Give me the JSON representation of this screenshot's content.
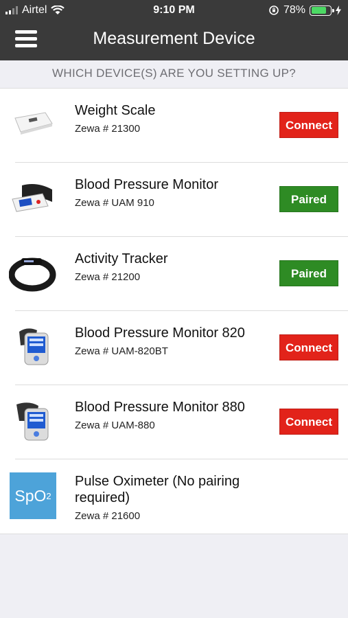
{
  "status": {
    "carrier": "Airtel",
    "time": "9:10 PM",
    "battery": "78%",
    "battery_level": 0.78
  },
  "header": {
    "title": "Measurement Device"
  },
  "subheader": "WHICH DEVICE(S) ARE YOU SETTING UP?",
  "devices": [
    {
      "name": "Weight Scale",
      "model": "Zewa # 21300",
      "action": "Connect",
      "icon": "weight-scale-icon"
    },
    {
      "name": "Blood Pressure Monitor",
      "model": "Zewa # UAM 910",
      "action": "Paired",
      "icon": "bp-monitor-icon"
    },
    {
      "name": "Activity Tracker",
      "model": "Zewa # 21200",
      "action": "Paired",
      "icon": "activity-tracker-icon"
    },
    {
      "name": "Blood Pressure Monitor 820",
      "model": "Zewa # UAM-820BT",
      "action": "Connect",
      "icon": "bp-monitor-icon"
    },
    {
      "name": "Blood Pressure Monitor 880",
      "model": "Zewa # UAM-880",
      "action": "Connect",
      "icon": "bp-monitor-icon"
    },
    {
      "name": "Pulse Oximeter (No pairing required)",
      "model": "Zewa # 21600",
      "action": "",
      "icon": "spo2-icon",
      "icon_text": "SpO",
      "icon_sub": "2"
    }
  ],
  "colors": {
    "connect": "#e2231a",
    "paired": "#2e8b24",
    "topbar": "#3a3a3a",
    "spo2": "#4da3d9"
  }
}
